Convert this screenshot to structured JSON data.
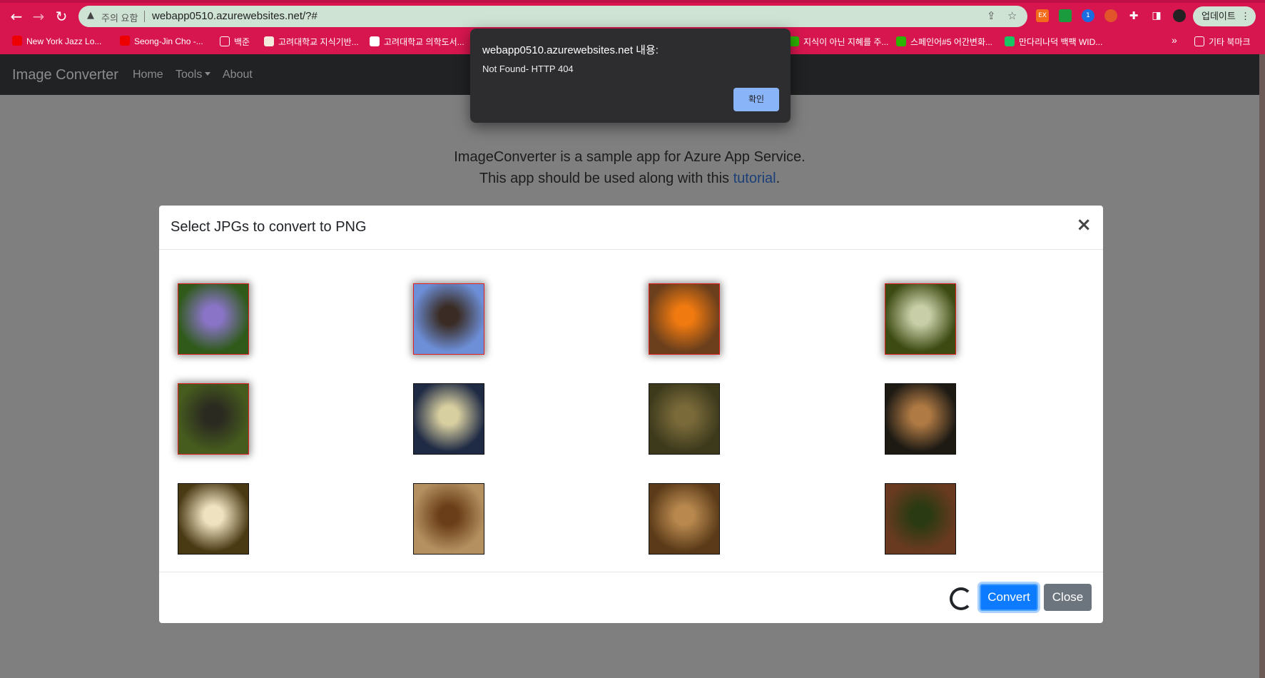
{
  "browser": {
    "security_label": "주의 요함",
    "url": "webapp0510.azurewebsites.net/?#",
    "update_label": "업데이트",
    "overflow_label": "»",
    "bookmarks": [
      {
        "label": "New York Jazz Lo...",
        "icon": "youtube-icon"
      },
      {
        "label": "Seong-Jin Cho -...",
        "icon": "youtube-icon"
      },
      {
        "label": "백준",
        "icon": "folder-icon"
      },
      {
        "label": "고려대학교 지식기반...",
        "icon": "site-icon"
      },
      {
        "label": "고려대학교 의학도서...",
        "icon": "shield-icon"
      },
      {
        "label": "지식이 아닌 지혜를 주...",
        "icon": "site-icon"
      },
      {
        "label": "스페인어#5 어간변화...",
        "icon": "naver-icon"
      },
      {
        "label": "만다리나덕 백팩 WID...",
        "icon": "site-icon"
      },
      {
        "label": "기타 북마크",
        "icon": "folder-icon"
      }
    ],
    "extension_labels": [
      "EX"
    ]
  },
  "site": {
    "brand": "Image Converter",
    "nav": {
      "home": "Home",
      "tools": "Tools",
      "about": "About"
    },
    "intro_line1": "ImageConverter is a sample app for Azure App Service.",
    "intro_line2_prefix": "This app should be used along with this ",
    "intro_link": "tutorial",
    "intro_line2_suffix": "."
  },
  "modal": {
    "title": "Select JPGs to convert to PNG",
    "close_symbol": "×",
    "convert_label": "Convert",
    "close_label": "Close",
    "images": [
      {
        "subject": "lavender flower",
        "selected": true,
        "colors": [
          "#2f5a1a",
          "#8a74c8"
        ]
      },
      {
        "subject": "bird on branches",
        "selected": true,
        "colors": [
          "#6d8fd8",
          "#3a2c24"
        ]
      },
      {
        "subject": "orange fruit",
        "selected": true,
        "colors": [
          "#6b3f1c",
          "#f07a10"
        ]
      },
      {
        "subject": "park fountain",
        "selected": true,
        "colors": [
          "#3d4a12",
          "#c8cfa8"
        ]
      },
      {
        "subject": "forest pond",
        "selected": true,
        "colors": [
          "#465c1e",
          "#2b2a20"
        ]
      },
      {
        "subject": "reeds at sunset",
        "selected": false,
        "colors": [
          "#1f2a44",
          "#d8cfa0"
        ]
      },
      {
        "subject": "grass leaves",
        "selected": false,
        "colors": [
          "#3d3a1c",
          "#7a6a3a"
        ]
      },
      {
        "subject": "food platter",
        "selected": false,
        "colors": [
          "#1d1a14",
          "#b07a44"
        ]
      },
      {
        "subject": "ceiling lamp",
        "selected": false,
        "colors": [
          "#4a3a14",
          "#efe2c0"
        ]
      },
      {
        "subject": "wooden railing",
        "selected": false,
        "colors": [
          "#b49060",
          "#6a3e18"
        ]
      },
      {
        "subject": "wood planks",
        "selected": false,
        "colors": [
          "#5a3a18",
          "#b8884e"
        ]
      },
      {
        "subject": "rusty post",
        "selected": false,
        "colors": [
          "#6a3a20",
          "#2a3a12"
        ]
      }
    ]
  },
  "alert": {
    "title": "webapp0510.azurewebsites.net 내용:",
    "message": "Not Found- HTTP 404",
    "ok_label": "확인"
  }
}
